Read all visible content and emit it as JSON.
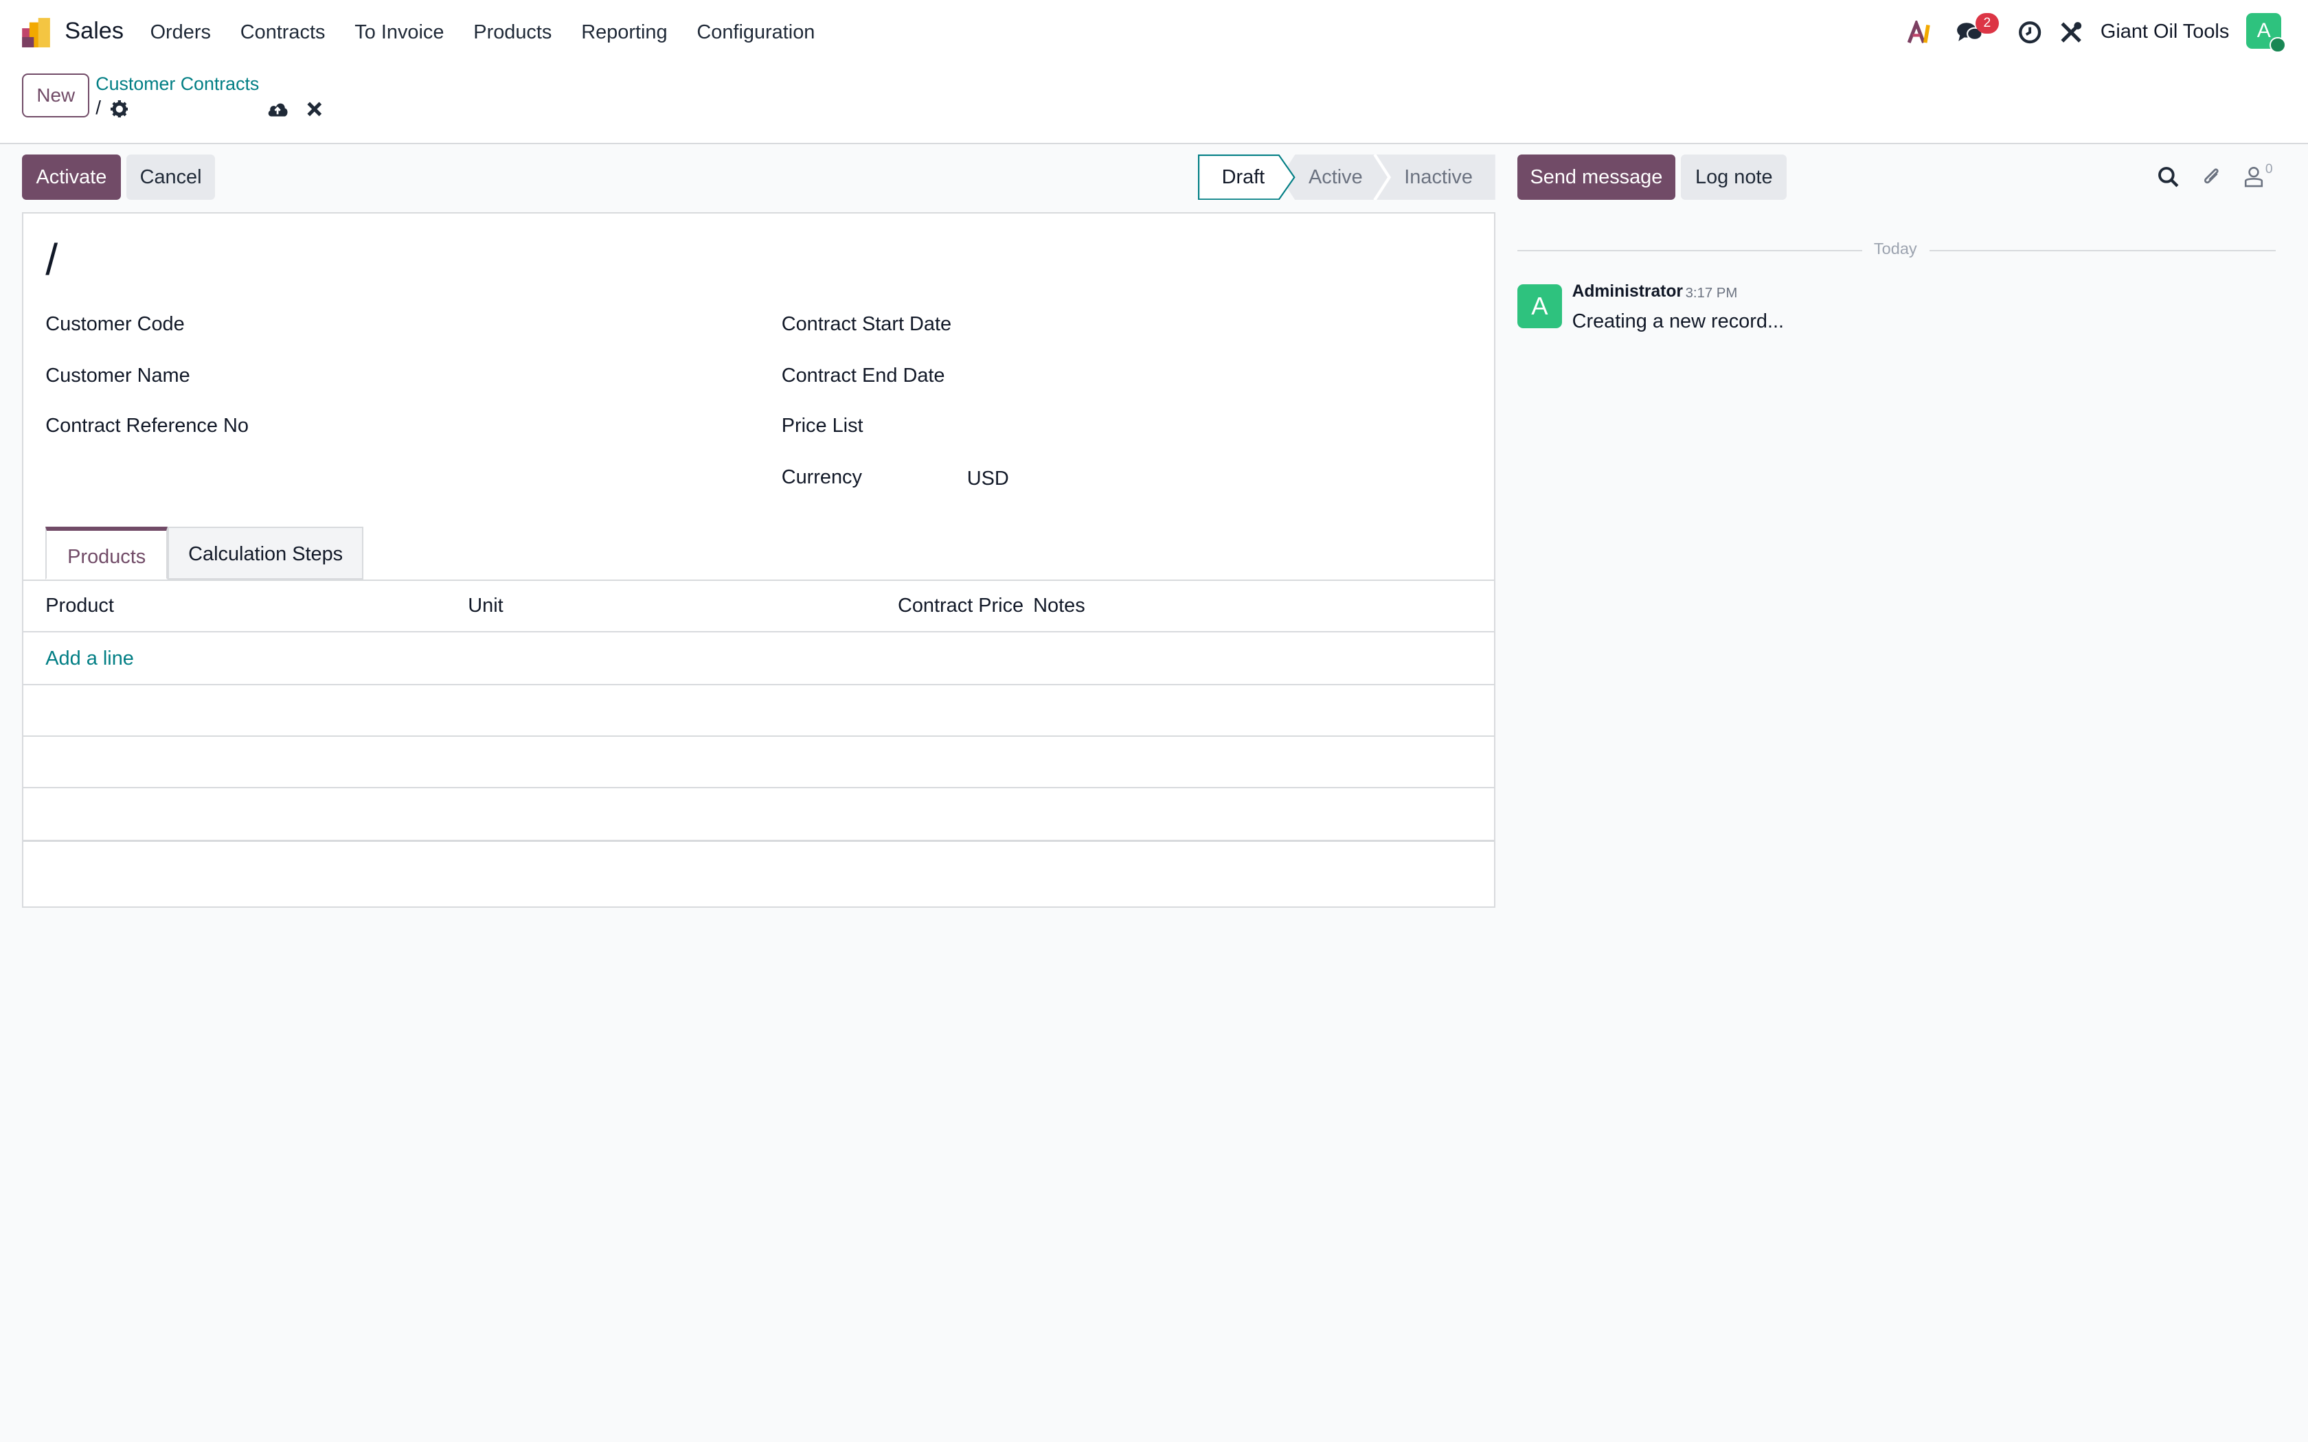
{
  "app": {
    "name": "Sales"
  },
  "menu": {
    "items": [
      {
        "label": "Orders"
      },
      {
        "label": "Contracts"
      },
      {
        "label": "To Invoice"
      },
      {
        "label": "Products"
      },
      {
        "label": "Reporting"
      },
      {
        "label": "Configuration"
      }
    ]
  },
  "systray": {
    "ai_icon": "ai-icon",
    "messages_icon": "chat-bubbles-icon",
    "messages_count": "2",
    "activity_icon": "clock-icon",
    "debug_icon": "tools-icon",
    "company": "Giant Oil Tools",
    "avatar_letter": "A"
  },
  "breadcrumb": {
    "new_label": "New",
    "parent": "Customer Contracts",
    "current": "/"
  },
  "statusbar": {
    "activate_label": "Activate",
    "cancel_label": "Cancel",
    "stages": [
      "Draft",
      "Active",
      "Inactive"
    ],
    "current_stage": "Draft"
  },
  "form": {
    "title": "/",
    "fields_left": [
      {
        "label": "Customer Code",
        "value": ""
      },
      {
        "label": "Customer Name",
        "value": ""
      },
      {
        "label": "Contract Reference No",
        "value": ""
      }
    ],
    "fields_right": [
      {
        "label": "Contract Start Date",
        "value": ""
      },
      {
        "label": "Contract End Date",
        "value": ""
      },
      {
        "label": "Price List",
        "value": ""
      },
      {
        "label": "Currency",
        "value": "USD"
      }
    ],
    "tabs": [
      {
        "label": "Products",
        "active": true
      },
      {
        "label": "Calculation Steps",
        "active": false
      }
    ],
    "table": {
      "columns": [
        "Product",
        "Unit",
        "Contract Price",
        "Notes"
      ],
      "add_line_label": "Add a line"
    }
  },
  "chatter": {
    "send_message_label": "Send message",
    "log_note_label": "Log note",
    "followers_count": "0",
    "date_separator": "Today",
    "messages": [
      {
        "avatar": "A",
        "author": "Administrator",
        "time": "3:17 PM",
        "body": "Creating a new record..."
      }
    ]
  },
  "colors": {
    "brand": "#714b67",
    "link": "#017e84",
    "avatar": "#2ec27e",
    "badge": "#dc3545"
  }
}
